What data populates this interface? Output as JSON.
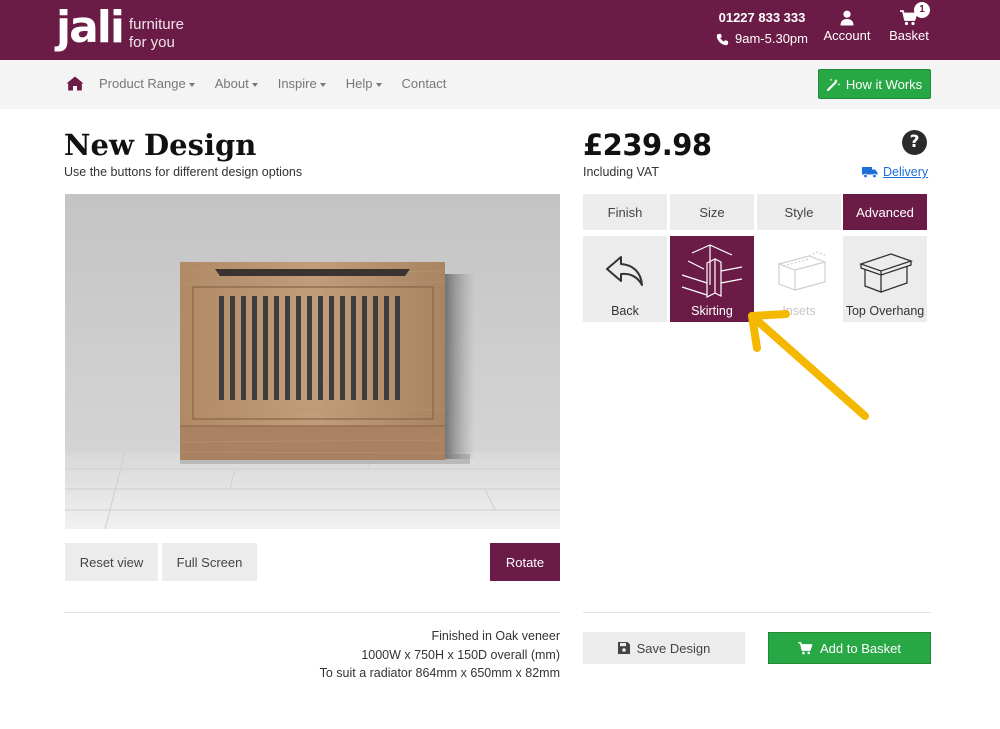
{
  "header": {
    "logo_word": "jali",
    "logo_tag_line1": "furniture",
    "logo_tag_line2": "for you",
    "phone": "01227 833 333",
    "hours": "9am-5.30pm",
    "account_label": "Account",
    "basket_label": "Basket",
    "basket_count": "1"
  },
  "nav": {
    "items": [
      "Product Range",
      "About",
      "Inspire",
      "Help",
      "Contact"
    ],
    "how_it_works": "How it Works"
  },
  "design": {
    "title": "New Design",
    "subtitle": "Use the buttons for different design options",
    "reset_view": "Reset view",
    "full_screen": "Full Screen",
    "rotate": "Rotate"
  },
  "pricing": {
    "price": "£239.98",
    "vat_note": "Including VAT",
    "help_glyph": "?",
    "delivery": "Delivery"
  },
  "tabs": {
    "items": [
      "Finish",
      "Size",
      "Style",
      "Advanced"
    ],
    "active": "Advanced"
  },
  "options": {
    "items": [
      "Back",
      "Skirting",
      "Insets",
      "Top Overhang"
    ],
    "active": "Skirting",
    "disabled": "Insets"
  },
  "spec": {
    "finish": "Finished in Oak veneer",
    "dimensions": "1000W x 750H x 150D overall (mm)",
    "radiator": "To suit a radiator 864mm x 650mm x 82mm"
  },
  "actions": {
    "save_design": "Save Design",
    "add_to_basket": "Add to Basket"
  },
  "colors": {
    "brand": "#6b1c46",
    "green": "#28a745",
    "link": "#1d6fd8",
    "annotation_arrow": "#f5b800"
  }
}
